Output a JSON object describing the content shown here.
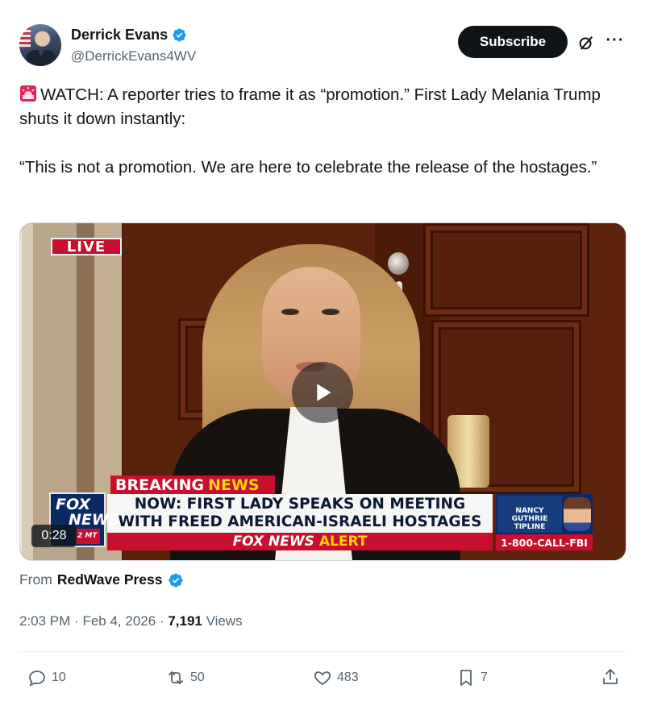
{
  "author": {
    "name": "Derrick Evans",
    "handle": "@DerrickEvans4WV",
    "verified_icon": "verified-badge-icon",
    "avatar_icon": "avatar"
  },
  "header": {
    "subscribe_label": "Subscribe",
    "grok_icon": "grok-icon",
    "more_icon": "more-icon",
    "more_label": "···"
  },
  "tweet": {
    "paragraph1": "WATCH: A reporter tries to frame it as “promotion.” First Lady Melania Trump shuts it down instantly:",
    "paragraph2": "“This is not a promotion. We are here to celebrate the release of the hostages.”",
    "emoji_icon": "siren-icon"
  },
  "video": {
    "live_label": "LIVE",
    "breaking_word": "BREAKING",
    "news_word": "NEWS",
    "headline_line1": "NOW: FIRST LADY SPEAKS ON MEETING",
    "headline_line2": "WITH FREED AMERICAN-ISRAELI HOSTAGES",
    "alert_prefix": "FOX NEWS",
    "alert_word": "ALERT",
    "logo_line1": "FOX",
    "logo_line2": "NEWS",
    "logo_time": "2 MT",
    "duration": "0:28",
    "tipline_title": "NANCY GUTHRIE TIPLINE",
    "tipline_phone": "1-800-CALL-FBI",
    "play_icon": "play-icon"
  },
  "source": {
    "prefix": "From",
    "name": "RedWave Press"
  },
  "meta": {
    "time": "2:03 PM",
    "date": "Feb 4, 2026",
    "separator": "·",
    "views_count": "7,191",
    "views_label": "Views"
  },
  "actions": {
    "replies": "10",
    "reposts": "50",
    "likes": "483",
    "bookmarks": "7"
  },
  "colors": {
    "accent": "#1d9bf0",
    "fox_red": "#c8102e",
    "fox_blue": "#0a2a66",
    "fox_yellow": "#ffd400",
    "text_secondary": "#536471"
  }
}
